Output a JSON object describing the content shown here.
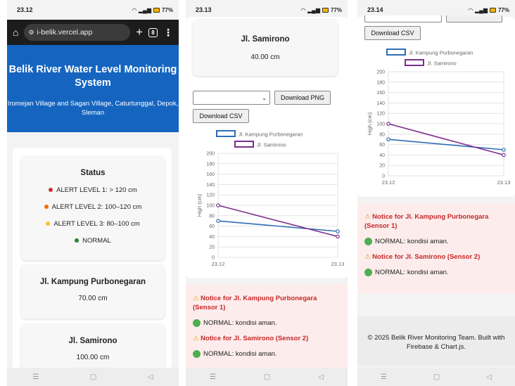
{
  "colors": {
    "header_bg": "#1565c0",
    "alert1": "#d32f2f",
    "alert2": "#ef6c00",
    "alert3": "#fbc02d",
    "normal": "#2e7d32",
    "series1": "#2e6db4",
    "series2": "#7b2d8e",
    "notice_title": "#c62828"
  },
  "screens": [
    {
      "time": "23.12",
      "battery": "77%"
    },
    {
      "time": "23.13",
      "battery": "77%"
    },
    {
      "time": "23.14",
      "battery": "77%"
    }
  ],
  "browser": {
    "url": "i-belik.vercel.app",
    "tab_count": "8",
    "home_icon": "home-icon",
    "add_icon": "plus-icon",
    "menu_icon": "more-vert-icon"
  },
  "header": {
    "title": "Belik River Water Level Monitoring System",
    "subtitle": "Iromejan Village and Sagan Village, Caturtunggal, Depok, Sleman"
  },
  "status": {
    "title": "Status",
    "items": [
      {
        "label": "ALERT LEVEL 1: > 120 cm",
        "color": "#d32f2f"
      },
      {
        "label": "ALERT LEVEL 2: 100–120 cm",
        "color": "#ef6c00"
      },
      {
        "label": "ALERT LEVEL 3: 80–100 cm",
        "color": "#fbc02d"
      },
      {
        "label": "NORMAL",
        "color": "#2e7d32"
      }
    ]
  },
  "sensors_s1": [
    {
      "name": "Jl. Kampung Purbonegaran",
      "value": "70.00 cm"
    },
    {
      "name": "Jl. Samirono",
      "value": "100.00 cm"
    }
  ],
  "sensor_s2": {
    "name": "Jl. Samirono",
    "value": "40.00 cm"
  },
  "controls": {
    "download_png": "Download PNG",
    "download_csv": "Download CSV",
    "select_value": ""
  },
  "chart_data": [
    {
      "type": "line",
      "x": [
        "23.12",
        "23.13"
      ],
      "series": [
        {
          "name": "Jl. Kampung Purbonegaran",
          "values": [
            70,
            50
          ],
          "color": "#2e6db4"
        },
        {
          "name": "Jl. Samirono",
          "values": [
            100,
            40
          ],
          "color": "#7b2d8e"
        }
      ],
      "ylabel": "High (cm)",
      "ylim": [
        0,
        200
      ],
      "yticks": [
        0,
        20,
        40,
        60,
        80,
        100,
        120,
        140,
        160,
        180,
        200
      ],
      "grid": true,
      "legend": "top"
    },
    {
      "type": "line",
      "x": [
        "23.12",
        "23.13"
      ],
      "series": [
        {
          "name": "Jl. Kampung Purbonegaran",
          "values": [
            70,
            50
          ],
          "color": "#2e6db4"
        },
        {
          "name": "Jl. Samirono",
          "values": [
            100,
            40
          ],
          "color": "#7b2d8e"
        }
      ],
      "ylabel": "High (cm)",
      "ylim": [
        0,
        200
      ],
      "yticks": [
        0,
        20,
        40,
        60,
        80,
        100,
        120,
        140,
        160,
        180,
        200
      ],
      "grid": true,
      "legend": "top"
    }
  ],
  "notices": [
    {
      "title": "Notice for Jl. Kampung Purbonegara (Sensor 1)",
      "status": "NORMAL: kondisi aman."
    },
    {
      "title": "Notice for Jl. Samirono (Sensor 2)",
      "status": "NORMAL: kondisi aman."
    }
  ],
  "footer": {
    "text": "© 2025 Belik River Monitoring Team. Built with Firebase & Chart.js."
  },
  "nav_icons": [
    "recent-apps-icon",
    "home-circle-icon",
    "back-icon"
  ]
}
